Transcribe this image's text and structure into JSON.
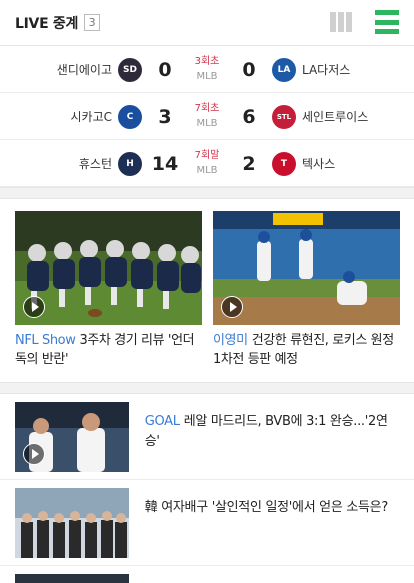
{
  "header": {
    "title": "LIVE 중계",
    "count": "3",
    "accent": "#2db560"
  },
  "games": [
    {
      "home_name": "샌디에이고",
      "home_logo": "SD",
      "home_logo_color": "#2f2a3a",
      "home_score": "0",
      "inning": "3회초",
      "league": "MLB",
      "away_score": "0",
      "away_logo": "LA",
      "away_logo_color": "#1d5aa6",
      "away_name": "LA다저스"
    },
    {
      "home_name": "시카고C",
      "home_logo": "C",
      "home_logo_color": "#1a4fa0",
      "home_score": "3",
      "inning": "7회초",
      "league": "MLB",
      "away_score": "6",
      "away_logo": "STL",
      "away_logo_color": "#c41e3a",
      "away_name": "세인트루이스"
    },
    {
      "home_name": "휴스턴",
      "home_logo": "H",
      "home_logo_color": "#1e2f55",
      "home_score": "14",
      "inning": "7회말",
      "league": "MLB",
      "away_score": "2",
      "away_logo": "T",
      "away_logo_color": "#c8102e",
      "away_name": "텍사스"
    }
  ],
  "video_cards": [
    {
      "source": "NFL Show",
      "title": "3주차 경기 리뷰 '언더독의 반란'",
      "thumb_icon": "football-linemen-image"
    },
    {
      "source": "이영미",
      "title": "건강한 류현진, 로키스 원정 1차전 등판 예정",
      "thumb_icon": "baseball-players-image"
    }
  ],
  "list_items": [
    {
      "source": "GOAL",
      "title": "레알 마드리드, BVB에 3:1 완승...'2연승'",
      "thumb_icon": "soccer-players-image",
      "has_play": true
    },
    {
      "source": "",
      "title": "韓 여자배구 '살인적인 일정'에서 얻은 소득은?",
      "thumb_icon": "volleyball-team-photo",
      "has_play": false
    }
  ]
}
